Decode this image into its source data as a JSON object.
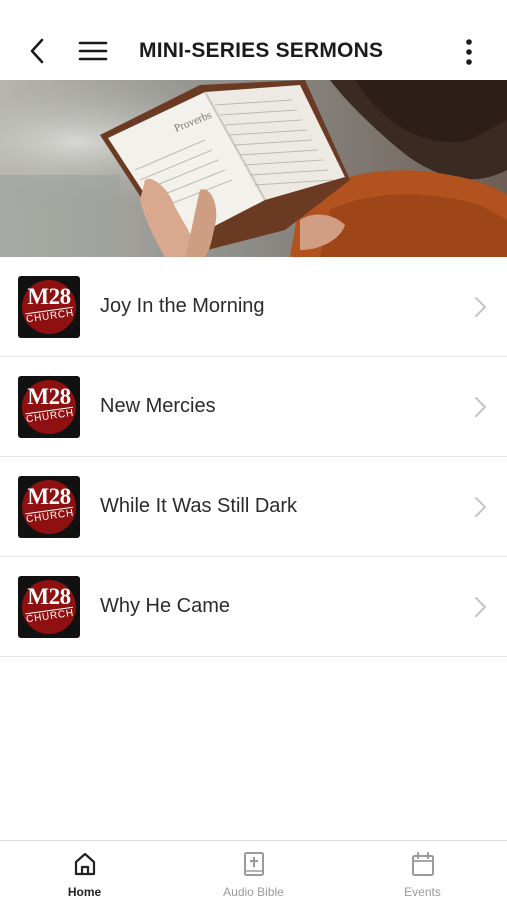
{
  "header": {
    "title": "MINI-SERIES SERMONS"
  },
  "hero": {
    "book_text": "Proverbs"
  },
  "series": [
    {
      "label": "Joy In the Morning",
      "logo_main": "M28",
      "logo_sub": "CHURCH"
    },
    {
      "label": "New Mercies",
      "logo_main": "M28",
      "logo_sub": "CHURCH"
    },
    {
      "label": "While It Was Still Dark",
      "logo_main": "M28",
      "logo_sub": "CHURCH"
    },
    {
      "label": "Why He Came",
      "logo_main": "M28",
      "logo_sub": "CHURCH"
    }
  ],
  "tabbar": {
    "tabs": [
      {
        "label": "Home",
        "icon": "home-icon",
        "active": true
      },
      {
        "label": "Audio Bible",
        "icon": "bible-icon",
        "active": false
      },
      {
        "label": "Events",
        "icon": "calendar-icon",
        "active": false
      }
    ]
  },
  "colors": {
    "logo_red": "#8e1010",
    "tab_active": "#222222",
    "tab_inactive": "#9a9a9a"
  }
}
